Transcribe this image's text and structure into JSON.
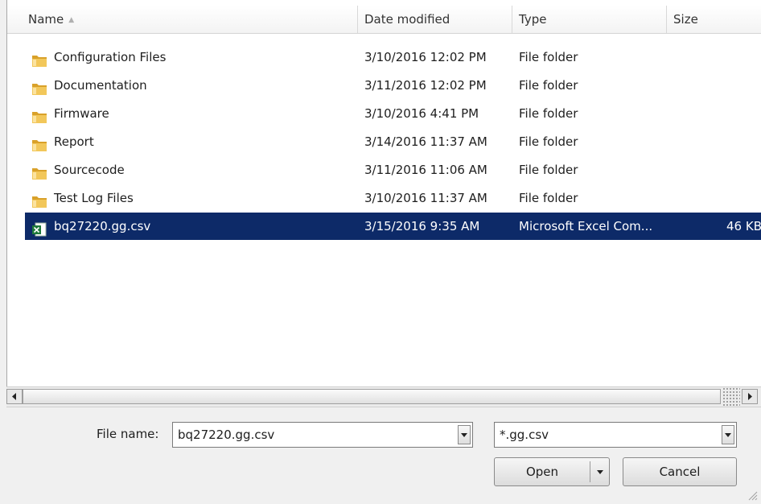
{
  "columns": {
    "name": "Name",
    "date": "Date modified",
    "type": "Type",
    "size": "Size"
  },
  "files": [
    {
      "name": "Configuration Files",
      "date": "3/10/2016 12:02 PM",
      "type": "File folder",
      "size": "",
      "icon": "folder-icon"
    },
    {
      "name": "Documentation",
      "date": "3/11/2016 12:02 PM",
      "type": "File folder",
      "size": "",
      "icon": "folder-icon"
    },
    {
      "name": "Firmware",
      "date": "3/10/2016 4:41 PM",
      "type": "File folder",
      "size": "",
      "icon": "folder-icon"
    },
    {
      "name": "Report",
      "date": "3/14/2016 11:37 AM",
      "type": "File folder",
      "size": "",
      "icon": "folder-icon"
    },
    {
      "name": "Sourcecode",
      "date": "3/11/2016 11:06 AM",
      "type": "File folder",
      "size": "",
      "icon": "folder-icon"
    },
    {
      "name": "Test Log Files",
      "date": "3/10/2016 11:37 AM",
      "type": "File folder",
      "size": "",
      "icon": "folder-icon"
    },
    {
      "name": "bq27220.gg.csv",
      "date": "3/15/2016 9:35 AM",
      "type": "Microsoft Excel Com...",
      "size": "46 KB",
      "icon": "excel-file-icon",
      "selected": true
    }
  ],
  "footer": {
    "file_name_label": "File name:",
    "file_name_value": "bq27220.gg.csv",
    "filter_value": "*.gg.csv",
    "open_label": "Open",
    "cancel_label": "Cancel"
  },
  "colors": {
    "selection": "#0d2a68",
    "folder": "#e8b93c"
  }
}
